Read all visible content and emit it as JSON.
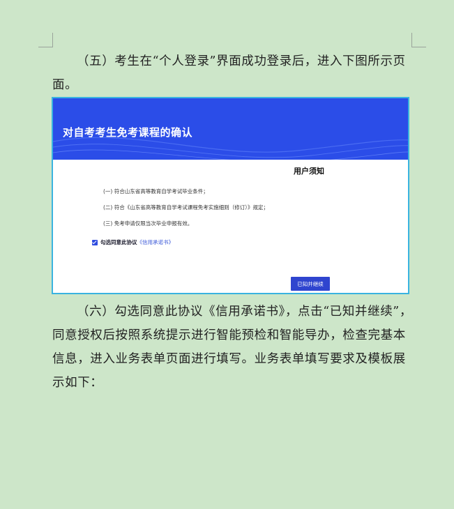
{
  "doc": {
    "para1": "（五）考生在“个人登录”界面成功登录后，进入下图所示页面。",
    "para2": "（六）勾选同意此协议《信用承诺书》，点击“已知并继续”，同意授权后按照系统提示进行智能预检和智能导办，检查完基本信息，进入业务表单页面进行填写。业务表单填写要求及模板展示如下："
  },
  "screenshot": {
    "header_title": "对自考考生免考课程的确认",
    "notice_title": "用户须知",
    "items": [
      "(一) 符合山东省高等教育自学考试毕业条件；",
      "(二) 符合《山东省高等教育自学考试课程免考实施细则（修订）》规定；",
      "(三) 免考申请仅限当次毕业申报有效。"
    ],
    "agree_label": "勾选同意此协议",
    "agree_link": "《信用承诺书》",
    "agree_checked": true,
    "continue_button": "已知并继续",
    "colors": {
      "header": "#2b4de8",
      "button": "#2f45cf",
      "border": "#39b3e0",
      "page_background": "#cde6c9"
    }
  }
}
